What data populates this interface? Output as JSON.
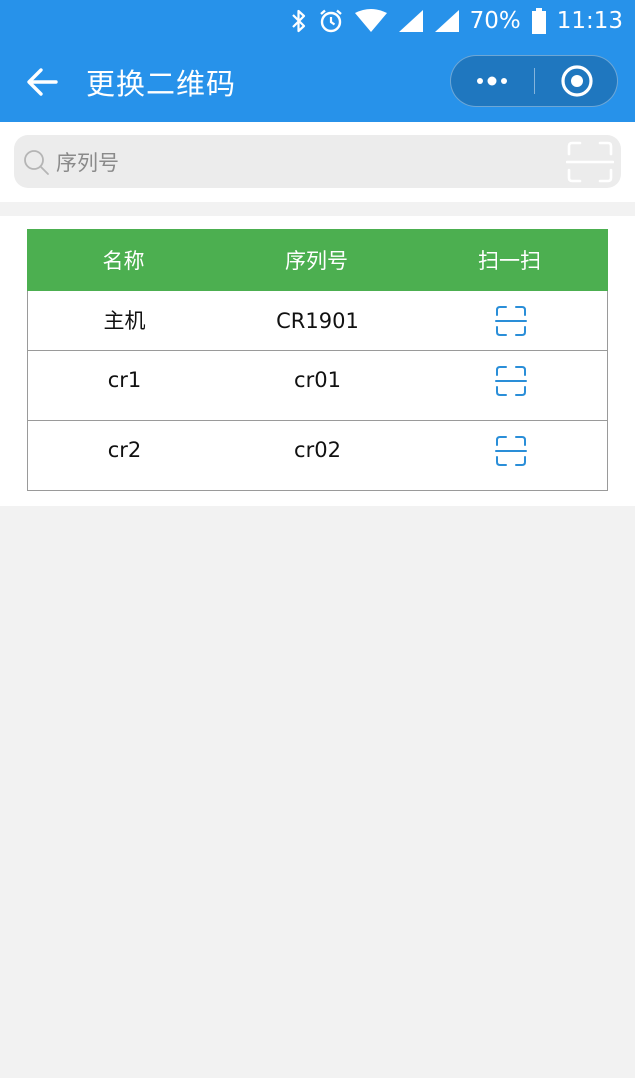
{
  "status_bar": {
    "battery_percent": "70%",
    "time": "11:13",
    "icons": [
      "bluetooth-icon",
      "alarm-icon",
      "wifi-icon",
      "signal-icon",
      "signal-icon",
      "battery-icon"
    ]
  },
  "header": {
    "title": "更换二维码",
    "back_icon": "arrow-left-icon",
    "more_icon": "more-dots-icon",
    "close_icon": "target-circle-icon"
  },
  "search": {
    "placeholder": "序列号",
    "value": "",
    "icon": "search-icon",
    "scan_icon": "scan-icon"
  },
  "table": {
    "columns": [
      "名称",
      "序列号",
      "扫一扫"
    ],
    "rows": [
      {
        "name": "主机",
        "serial": "CR1901",
        "scan_icon": "scan-icon"
      },
      {
        "name": "cr1",
        "serial": "cr01",
        "scan_icon": "scan-icon"
      },
      {
        "name": "cr2",
        "serial": "cr02",
        "scan_icon": "scan-icon"
      }
    ]
  },
  "colors": {
    "header_blue": "#2792ea",
    "table_header_green": "#4caf50",
    "scan_icon_blue": "#2a8ed8",
    "background_gray": "#f2f2f2"
  }
}
